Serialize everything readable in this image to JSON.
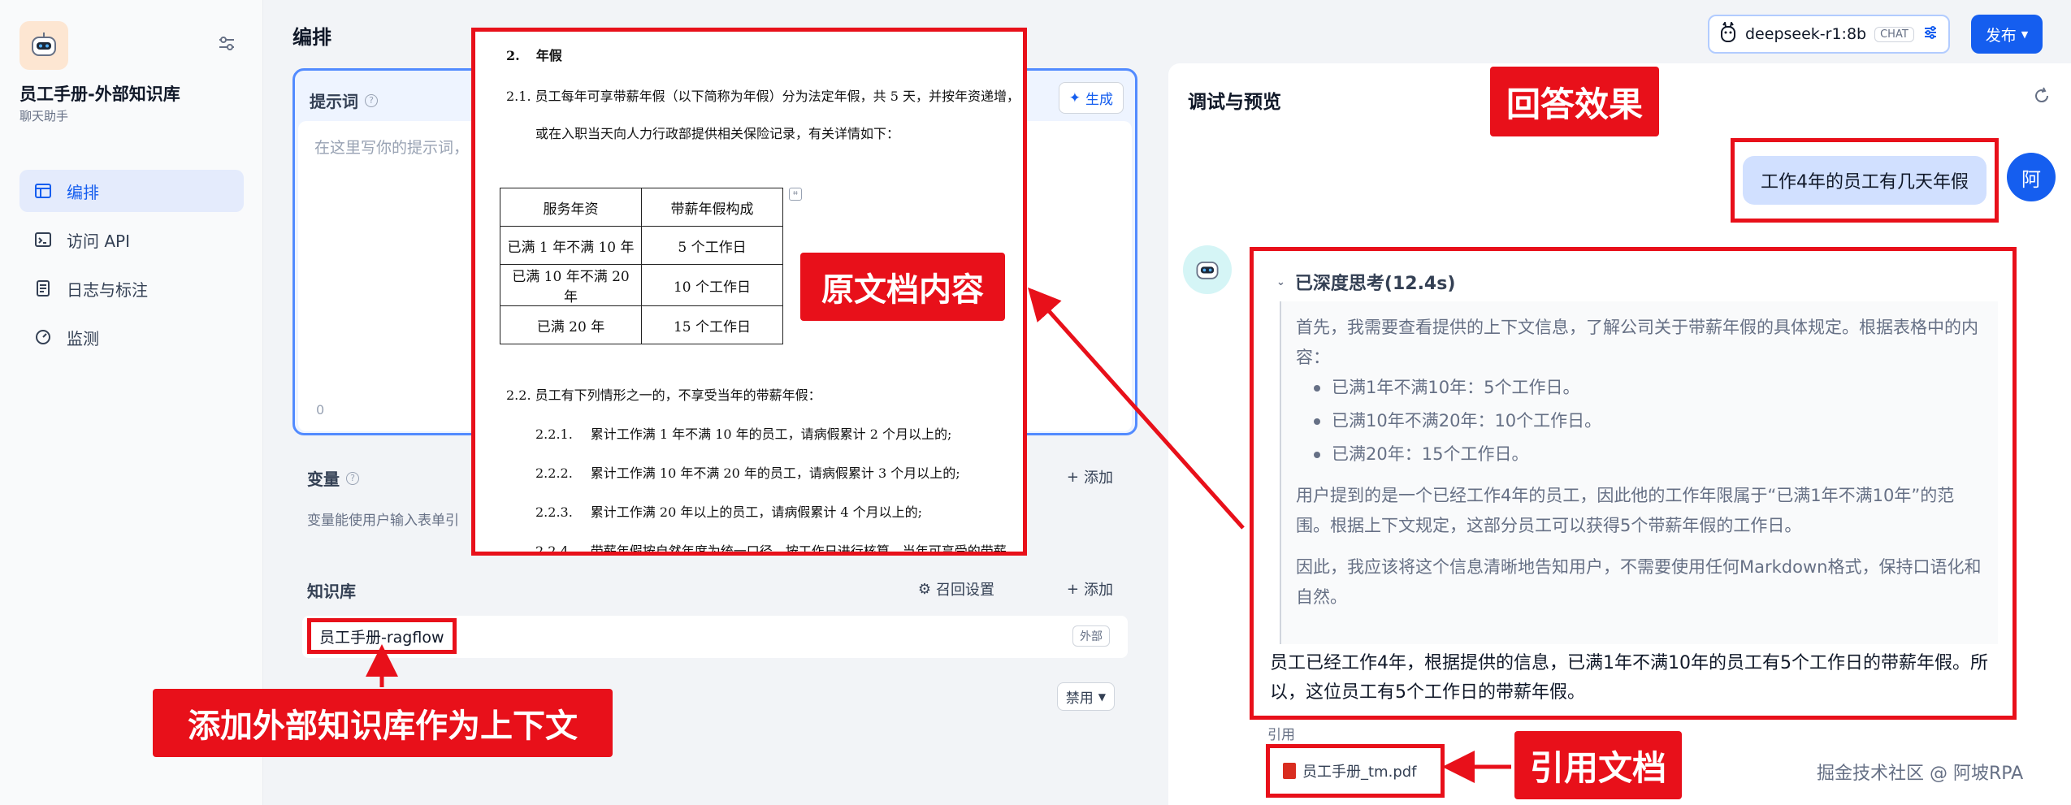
{
  "app": {
    "title": "员工手册-外部知识库",
    "subtitle": "聊天助手"
  },
  "nav": [
    {
      "label": "编排",
      "icon": "layout-icon",
      "active": true
    },
    {
      "label": "访问 API",
      "icon": "terminal-icon"
    },
    {
      "label": "日志与标注",
      "icon": "doc-log-icon"
    },
    {
      "label": "监测",
      "icon": "gauge-icon"
    }
  ],
  "header": {
    "title": "编排",
    "model_name": "deepseek-r1:8b",
    "model_badge": "CHAT",
    "publish_label": "发布"
  },
  "prompt": {
    "label": "提示词",
    "generate_label": "生成",
    "placeholder": "在这里写你的提示词，",
    "char_count": "0"
  },
  "variables": {
    "label": "变量",
    "add_label": "添加",
    "desc": "变量能使用户输入表单引"
  },
  "knowledge": {
    "label": "知识库",
    "recall_label": "召回设置",
    "add_label": "添加",
    "item_name": "员工手册-ragflow",
    "item_badge": "外部",
    "disable_label": "禁用"
  },
  "doc": {
    "section_num": "2.",
    "section_title": "年假",
    "p1a": "2.1. 员工每年可享带薪年假（以下简称为年假）分为法定年假，共 5 天，并按年资递增，",
    "p1b": "或在入职当天向人力行政部提供相关保险记录，有关详情如下：",
    "table_header": [
      "服务年资",
      "带薪年假构成"
    ],
    "table_rows": [
      [
        "已满 1 年不满 10 年",
        "5 个工作日"
      ],
      [
        "已满 10 年不满 20 年",
        "10 个工作日"
      ],
      [
        "已满 20 年",
        "15 个工作日"
      ]
    ],
    "p2": "2.2. 员工有下列情形之一的，不享受当年的带薪年假：",
    "items": [
      {
        "num": "2.2.1.",
        "text": "累计工作满 1 年不满 10 年的员工，请病假累计 2 个月以上的;"
      },
      {
        "num": "2.2.2.",
        "text": "累计工作满 10 年不满 20 年的员工，请病假累计 3 个月以上的;"
      },
      {
        "num": "2.2.3.",
        "text": "累计工作满 20 年以上的员工，请病假累计 4 个月以上的;"
      },
      {
        "num": "2.2.4.",
        "text": "带薪年假按自然年度为统一口径，按工作日进行核算，当年可享受的带薪"
      }
    ]
  },
  "chat": {
    "title": "调试与预览",
    "user_message": "工作4年的员工有几天年假",
    "user_avatar": "阿",
    "thinking_label": "已深度思考(12.4s)",
    "thinking_intro": "首先，我需要查看提供的上下文信息，了解公司关于带薪年假的具体规定。根据表格中的内容：",
    "thinking_bullets": [
      "已满1年不满10年：5个工作日。",
      "已满10年不满20年：10个工作日。",
      "已满20年：15个工作日。"
    ],
    "thinking_p2": "用户提到的是一个已经工作4年的员工，因此他的工作年限属于“已满1年不满10年”的范围。根据上下文规定，这部分员工可以获得5个带薪年假的工作日。",
    "thinking_p3": "因此，我应该将这个信息清晰地告知用户，不需要使用任何Markdown格式，保持口语化和自然。",
    "answer": "员工已经工作4年，根据提供的信息，已满1年不满10年的员工有5个工作日的带薪年假。所以，这位员工有5个工作日的带薪年假。",
    "citation_label": "引用",
    "citation_file": "员工手册_tm.pdf"
  },
  "callouts": {
    "doc": "原文档内容",
    "answer": "回答效果",
    "kb": "添加外部知识库作为上下文",
    "cite": "引用文档"
  },
  "watermark": "掘金技术社区 @ 阿坡RPA",
  "colors": {
    "accent": "#155eef",
    "annotation_red": "#e8101a"
  }
}
